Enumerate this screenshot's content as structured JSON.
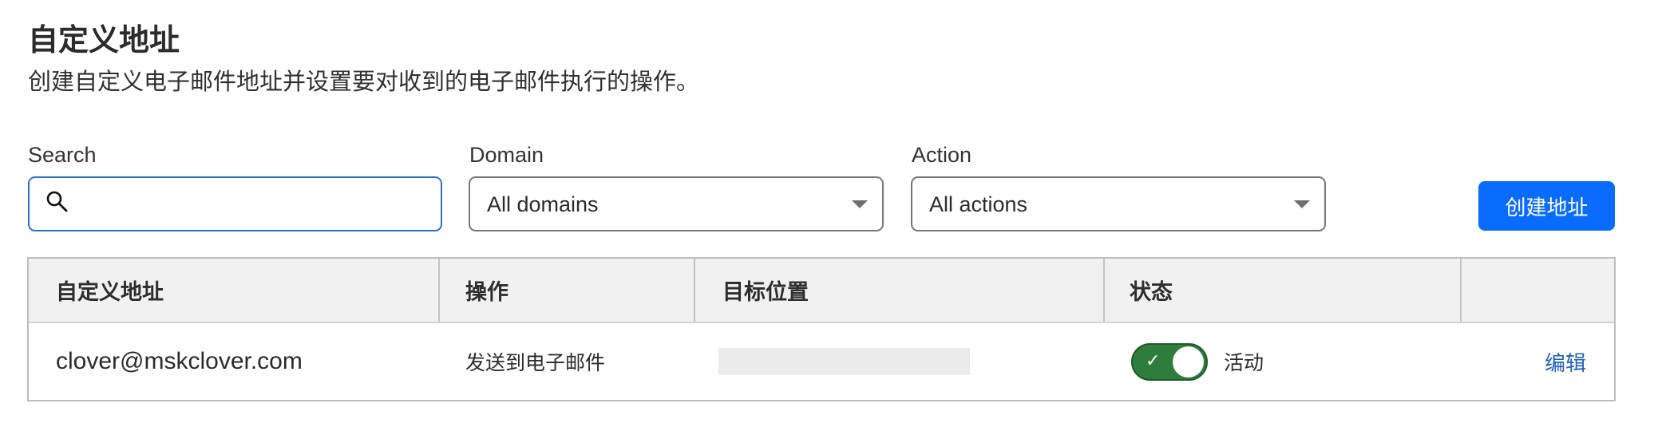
{
  "header": {
    "title": "自定义地址",
    "subtitle": "创建自定义电子邮件地址并设置要对收到的电子邮件执行的操作。"
  },
  "filters": {
    "search": {
      "label": "Search",
      "value": "",
      "placeholder": "",
      "icon": "search-icon"
    },
    "domain": {
      "label": "Domain",
      "selected": "All domains",
      "icon": "caret-down-icon"
    },
    "action": {
      "label": "Action",
      "selected": "All actions",
      "icon": "caret-down-icon"
    }
  },
  "toolbar": {
    "create_label": "创建地址"
  },
  "colors": {
    "primary": "#0a6cff",
    "toggle_on": "#2e7d3a",
    "link": "#1f5fbf",
    "header_bg": "#f1f1f1"
  },
  "table": {
    "columns": [
      "自定义地址",
      "操作",
      "目标位置",
      "状态",
      ""
    ],
    "rows": [
      {
        "address": "clover@mskclover.com",
        "action": "发送到电子邮件",
        "destination": "",
        "status_enabled": true,
        "status_icon": "check-icon",
        "status_label": "活动",
        "edit_label": "编辑"
      }
    ]
  }
}
